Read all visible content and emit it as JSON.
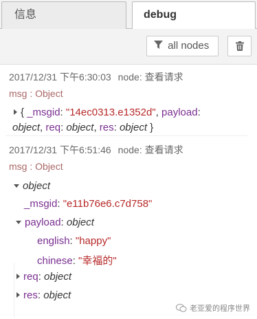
{
  "tabs": {
    "info_label": "信息",
    "debug_label": "debug"
  },
  "toolbar": {
    "filter_label": "all nodes",
    "filter_icon": "filter-icon",
    "clear_icon": "trash-icon"
  },
  "messages": [
    {
      "timestamp": "2017/12/31 下午6:30:03",
      "node": "node: 查看请求",
      "topic": "msg : Object",
      "summary": {
        "open": "{ ",
        "msgid_key": "_msgid",
        "msgid_val": "\"14ec0313.e1352d\"",
        "payload_key": "payload",
        "payload_val": "object",
        "req_key": "req",
        "req_val": "object",
        "res_key": "res",
        "res_val": "object",
        "close": " }"
      }
    },
    {
      "timestamp": "2017/12/31 下午6:51:46",
      "node": "node: 查看请求",
      "topic": "msg : Object",
      "root": "object",
      "msgid_key": "_msgid",
      "msgid_val": "\"e11b76e6.c7d758\"",
      "payload_key": "payload",
      "payload_val": "object",
      "english_key": "english",
      "english_val": "\"happy\"",
      "chinese_key": "chinese",
      "chinese_val": "\"幸福的\"",
      "req_key": "req",
      "req_val": "object",
      "res_key": "res",
      "res_val": "object"
    }
  ],
  "watermark": {
    "text": "老亚爱的程序世界",
    "icon": "wechat-icon"
  }
}
